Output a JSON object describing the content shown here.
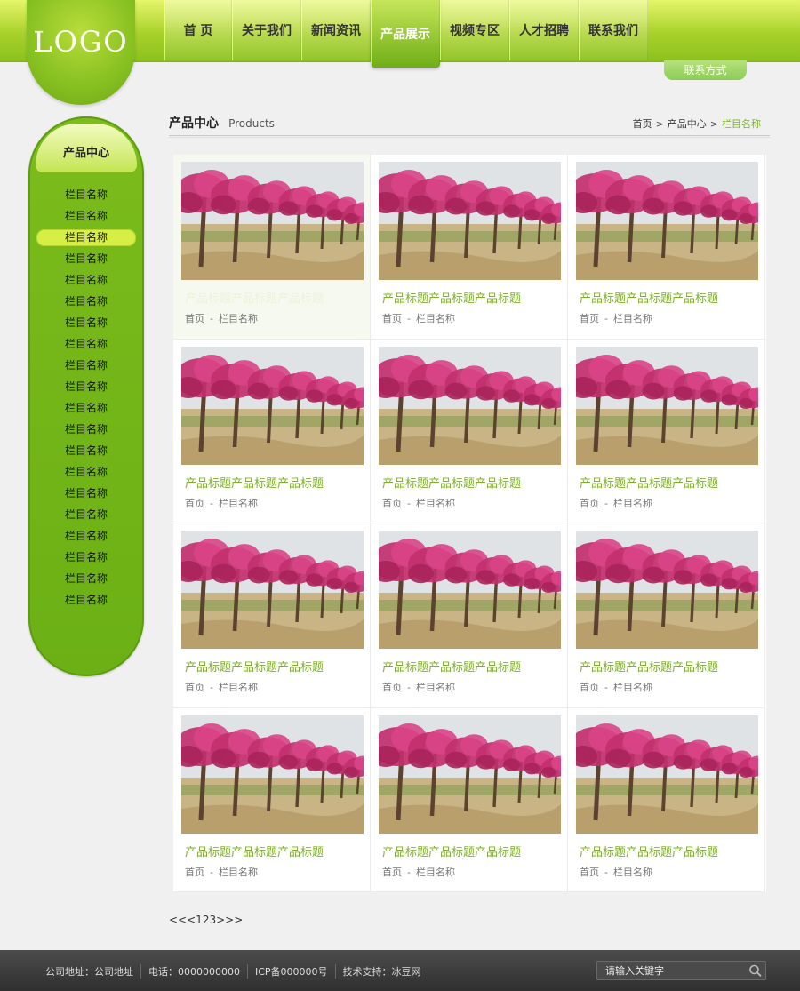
{
  "header": {
    "logo": "LOGO",
    "nav": [
      "首 页",
      "关于我们",
      "新闻资讯",
      "产品展示",
      "视频专区",
      "人才招聘",
      "联系我们"
    ],
    "active_nav_index": 3,
    "contact_tab": "联系方式"
  },
  "sidebar": {
    "title": "产品中心",
    "items": [
      "栏目名称",
      "栏目名称",
      "栏目名称",
      "栏目名称",
      "栏目名称",
      "栏目名称",
      "栏目名称",
      "栏目名称",
      "栏目名称",
      "栏目名称",
      "栏目名称",
      "栏目名称",
      "栏目名称",
      "栏目名称",
      "栏目名称",
      "栏目名称",
      "栏目名称",
      "栏目名称",
      "栏目名称",
      "栏目名称"
    ],
    "active_index": 2
  },
  "main": {
    "title_cn": "产品中心",
    "title_en": "Products",
    "breadcrumb": [
      "首页",
      "产品中心",
      "栏目名称"
    ],
    "breadcrumb_sep": ">",
    "products": [
      {
        "title": "产品标题产品标题产品标题",
        "meta_home": "首页",
        "meta_dash": "-",
        "meta_cat": "栏目名称"
      },
      {
        "title": "产品标题产品标题产品标题",
        "meta_home": "首页",
        "meta_dash": "-",
        "meta_cat": "栏目名称"
      },
      {
        "title": "产品标题产品标题产品标题",
        "meta_home": "首页",
        "meta_dash": "-",
        "meta_cat": "栏目名称"
      },
      {
        "title": "产品标题产品标题产品标题",
        "meta_home": "首页",
        "meta_dash": "-",
        "meta_cat": "栏目名称"
      },
      {
        "title": "产品标题产品标题产品标题",
        "meta_home": "首页",
        "meta_dash": "-",
        "meta_cat": "栏目名称"
      },
      {
        "title": "产品标题产品标题产品标题",
        "meta_home": "首页",
        "meta_dash": "-",
        "meta_cat": "栏目名称"
      },
      {
        "title": "产品标题产品标题产品标题",
        "meta_home": "首页",
        "meta_dash": "-",
        "meta_cat": "栏目名称"
      },
      {
        "title": "产品标题产品标题产品标题",
        "meta_home": "首页",
        "meta_dash": "-",
        "meta_cat": "栏目名称"
      },
      {
        "title": "产品标题产品标题产品标题",
        "meta_home": "首页",
        "meta_dash": "-",
        "meta_cat": "栏目名称"
      },
      {
        "title": "产品标题产品标题产品标题",
        "meta_home": "首页",
        "meta_dash": "-",
        "meta_cat": "栏目名称"
      },
      {
        "title": "产品标题产品标题产品标题",
        "meta_home": "首页",
        "meta_dash": "-",
        "meta_cat": "栏目名称"
      },
      {
        "title": "产品标题产品标题产品标题",
        "meta_home": "首页",
        "meta_dash": "-",
        "meta_cat": "栏目名称"
      }
    ],
    "highlighted_product_index": 0,
    "pagination": {
      "prev_all": "<<",
      "prev": "<",
      "pages": [
        "1",
        "2",
        "3"
      ],
      "next": ">",
      "next_all": ">>"
    }
  },
  "footer": {
    "info": [
      "公司地址：公司地址",
      "电话：0000000000",
      "ICP备000000号",
      "技术支持：冰豆网"
    ],
    "search_placeholder": "请输入关键字",
    "search_icon": "search-icon"
  },
  "colors": {
    "accent_green": "#7cb32a",
    "nav_bar": "#a8d12a",
    "sidebar_green": "#6bb015",
    "footer_bg": "#3a3a3a",
    "blossom_pink": "#c2306e"
  }
}
